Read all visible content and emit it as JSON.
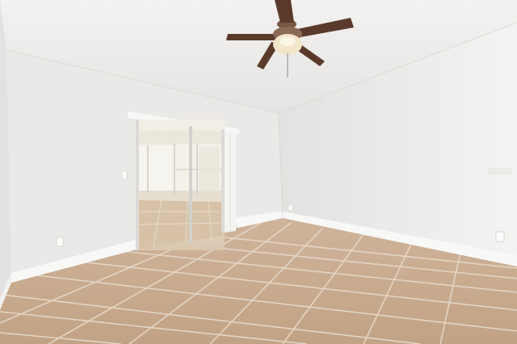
{
  "scene": {
    "description_label": "",
    "colors": {
      "ceiling": "#efeeec",
      "wall_left": "#f1f0ee",
      "wall_back": "#e9e8e6",
      "wall_right": "#f0efed",
      "floor": "#c8ab90",
      "grout": "#e2d6c8",
      "baseboard": "#fafafa",
      "fan_blade": "#5b3a2b",
      "fan_light": "#f2e6c8"
    },
    "objects": [
      "ceiling-fan",
      "sliding-glass-door",
      "sunroom",
      "light-switch",
      "wall-outlet",
      "tile-floor",
      "baseboard"
    ]
  }
}
